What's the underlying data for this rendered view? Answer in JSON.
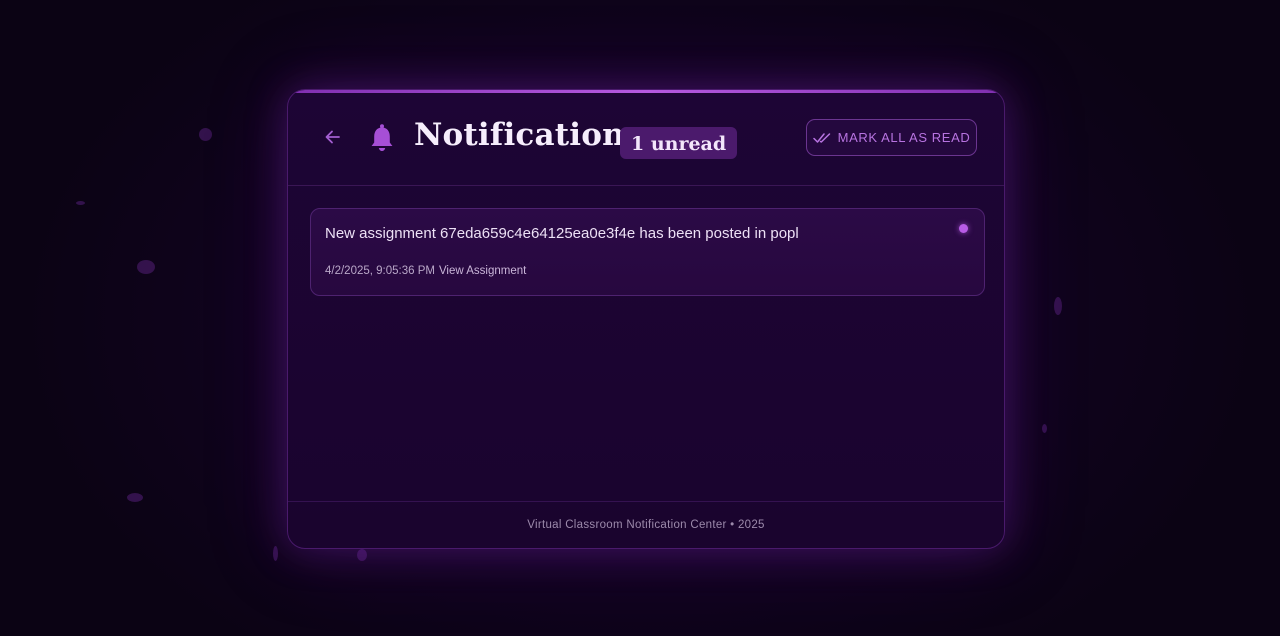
{
  "header": {
    "title": "Notifications",
    "unread_badge": "1 unread",
    "mark_all_label": "MARK ALL AS READ",
    "back_icon": "arrow-left-icon",
    "bell_icon": "bell-icon",
    "check_icon": "double-check-icon"
  },
  "notifications": [
    {
      "message": "New assignment 67eda659c4e64125ea0e3f4e has been posted in popl",
      "timestamp": "4/2/2025, 9:05:36 PM",
      "link_label": "View Assignment",
      "unread": true
    }
  ],
  "footer": {
    "text": "Virtual Classroom Notification Center • 2025"
  },
  "colors": {
    "background": "#0b0314",
    "panel": "#1d0535",
    "accent": "#b85ce6",
    "badge": "#4b1a6c"
  }
}
